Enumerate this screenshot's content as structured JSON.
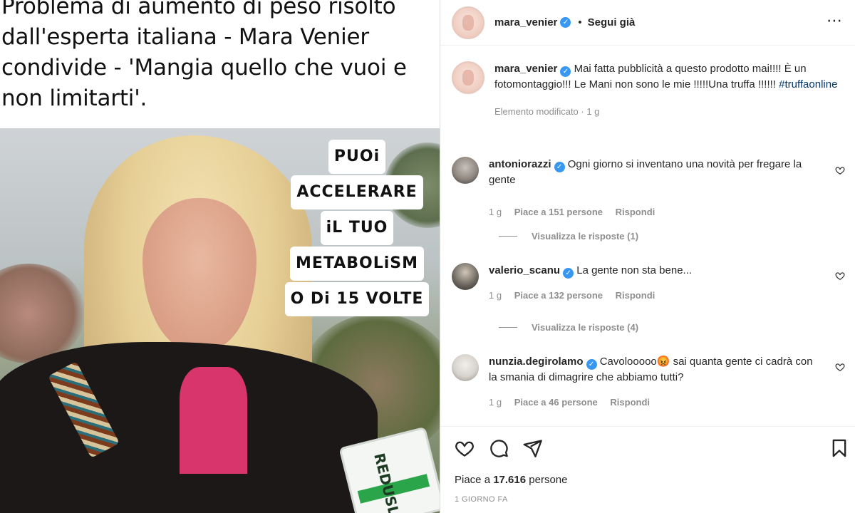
{
  "post_image": {
    "headline_lines": [
      "Problema di aumento di peso risolto",
      "dall'esperta italiana - Mara Venier",
      "condivide - 'Mangia quello che vuoi e",
      "non limitarti'."
    ],
    "overlay_lines": [
      "PUOi",
      "ACCELERARE",
      "iL TUO",
      "METABOLiSM",
      "O Di 15 VOLTE"
    ],
    "product_label": "REDUSLIM"
  },
  "header": {
    "username": "mara_venier",
    "separator": "•",
    "follow_label": "Segui già",
    "more_icon": "more-icon"
  },
  "caption": {
    "username": "mara_venier",
    "text": "Mai fatta pubblicità a questo prodotto mai!!!! È un fotomontaggio!!! Le Mani non sono le mie !!!!!Una truffa !!!!!!",
    "hashtag": "#truffaonline",
    "meta": "Elemento modificato · 1 g"
  },
  "comments": [
    {
      "username": "antoniorazzi",
      "text": "Ogni giorno si inventano una novità per fregare la gente",
      "time": "1 g",
      "likes": "Piace a 151 persone",
      "reply_label": "Rispondi",
      "view_replies": "Visualizza le risposte (1)"
    },
    {
      "username": "valerio_scanu",
      "text": "La gente non sta bene...",
      "time": "1 g",
      "likes": "Piace a 132 persone",
      "reply_label": "Rispondi",
      "view_replies": "Visualizza le risposte (4)"
    },
    {
      "username": "nunzia.degirolamo",
      "text": "Cavolooooo😡 sai quanta gente ci cadrà con la smania di dimagrire che abbiamo tutti?",
      "time": "1 g",
      "likes": "Piace a 46 persone",
      "reply_label": "Rispondi",
      "view_replies": ""
    }
  ],
  "actions": {
    "icons": [
      "heart-icon",
      "comment-icon",
      "share-icon",
      "bookmark-icon"
    ],
    "likes_prefix": "Piace a ",
    "likes_count": "17.616",
    "likes_suffix": " persone",
    "timestamp": "1 GIORNO FA"
  },
  "colors": {
    "verified": "#3897f0",
    "hashtag": "#00376b",
    "muted": "#8e8e8e",
    "text": "#262626"
  }
}
